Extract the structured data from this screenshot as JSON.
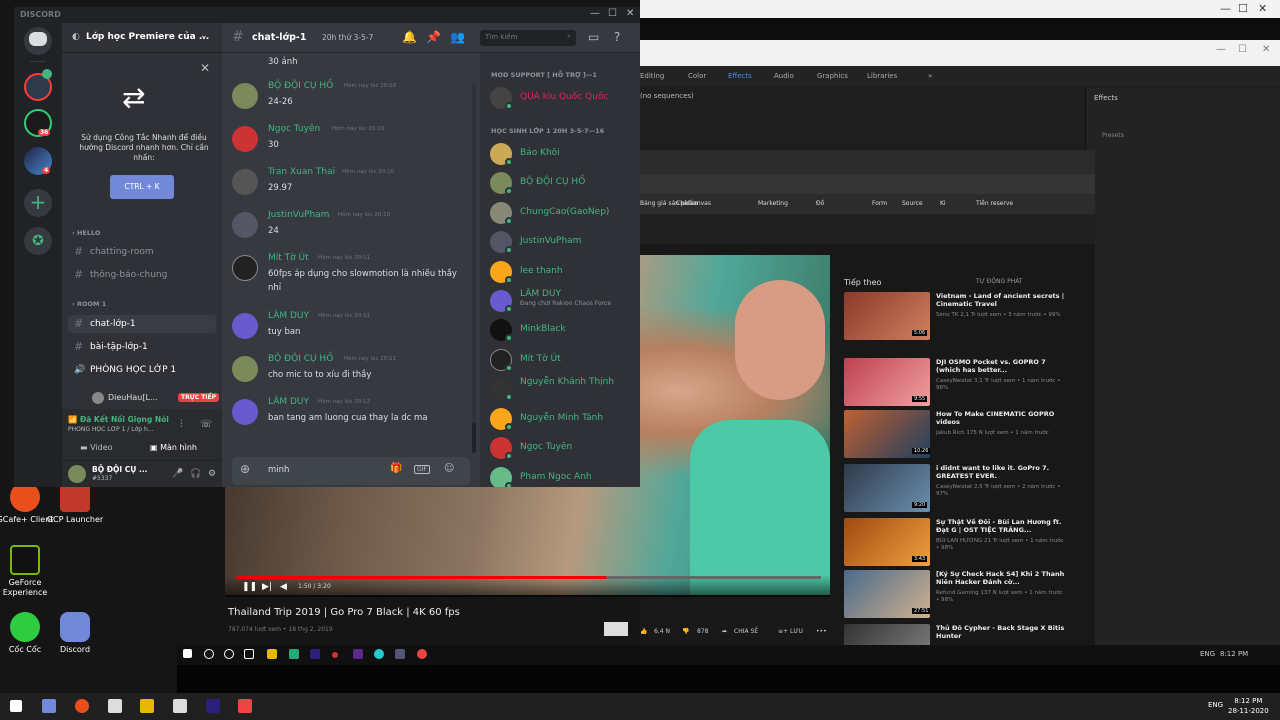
{
  "desktop_icons": [
    {
      "label": "GCafe+ Client"
    },
    {
      "label": "GCP Launcher"
    },
    {
      "label": "GeForce Experience"
    },
    {
      "label": "Cốc Cốc"
    },
    {
      "label": "Discord"
    }
  ],
  "background_app": {
    "menu": [
      "Editing",
      "Color",
      "Effects",
      "Audio",
      "Graphics",
      "Libraries"
    ],
    "effects_panel_title": "Effects",
    "effects_rows": [
      "Presets"
    ],
    "sequence_label": "(no sequences)"
  },
  "youtube": {
    "bookmarks": [
      "Bảng giá sản phẩm",
      "Chatsanvas",
      "Marketing",
      "Đồ",
      "Form",
      "Source",
      "Ki",
      "Tiền reserve"
    ],
    "up_next": "Tiếp theo",
    "autoplay": "TỰ ĐỘNG PHÁT",
    "video_title": "Thailand Trip 2019 | Go Pro 7 Black | 4K 60 fps",
    "video_views": "787.074 lượt xem • 18 thg 2, 2019",
    "video_time": "1:50 / 3:20",
    "likes": "6,4 N",
    "dislikes": "878",
    "share": "CHIA SẺ",
    "save": "LƯU",
    "sidebar": [
      {
        "title": "Vietnam - Land of ancient secrets | Cinematic Travel",
        "sub": "Simo TK\n2,1 Tr lượt xem • 3 năm trước • 99%",
        "dur": "5:06"
      },
      {
        "title": "DJI OSMO Pocket vs. GOPRO 7 (which has better...",
        "sub": "CaseyNeistat\n3,1 Tr lượt xem • 1 năm trước • 96%",
        "dur": "9:55"
      },
      {
        "title": "How To Make CINEMATIC GOPRO videos",
        "sub": "Jakub Rich\n175 N lượt xem • 1 năm trước",
        "dur": "10:26"
      },
      {
        "title": "i didnt want to like it. GoPro 7. GREATEST EVER.",
        "sub": "CaseyNeistat\n2,5 Tr lượt xem • 2 năm trước • 97%",
        "dur": "9:20"
      },
      {
        "title": "Sự Thật Về Đôi - Bùi Lan Hương ft. Đạt G | OST TIỆC TRĂNG...",
        "sub": "BÙI LAN HƯƠNG\n21 Tr lượt xem • 1 năm trước • 98%",
        "dur": "3:43"
      },
      {
        "title": "[Ký Sự Check Hack S4] Khi 2 Thanh Niên Hacker Đánh cờ...",
        "sub": "Refund Gaming\n137 N lượt xem • 1 năm trước • 98%",
        "dur": "27:51"
      },
      {
        "title": "Thủ Đô Cypher - Back Stage X Bitis Hunter",
        "sub": "",
        "dur": ""
      }
    ]
  },
  "discord": {
    "app_name": "DISCORD",
    "server_name": "Lớp học Premiere của ...",
    "guild_badges": [
      "36",
      "4"
    ],
    "promo": {
      "text": "Sử dụng Công Tắc Nhanh để điều hướng Discord nhanh hơn. Chỉ cần nhấn:",
      "button": "CTRL + K"
    },
    "categories": {
      "hello": "HELLO",
      "room": "ROOM 1"
    },
    "channels_hello": [
      "chatting-room",
      "thông-báo-chung"
    ],
    "channels_room": [
      "chat-lớp-1",
      "bài-tập-lớp-1",
      "PHÒNG HỌC LỚP 1"
    ],
    "voice_user": "DieuHau[L...",
    "live_label": "TRỰC TIẾP",
    "voice_connected": "Đã Kết Nối Giọng Nói",
    "voice_channel": "PHÒNG HỌC LỚP 1 / Lớp h...",
    "video_btn": "Video",
    "screen_btn": "Màn hình",
    "user": {
      "name": "BỘ ĐỘI CỤ ...",
      "tag": "#5337"
    },
    "channel": {
      "name": "chat-lớp-1",
      "topic": "20h thứ 3-5-7",
      "search_placeholder": "Tìm kiếm"
    },
    "messages": [
      {
        "name": "",
        "time": "",
        "text": "30 ảnh"
      },
      {
        "name": "BỘ ĐỘI CỤ HỒ",
        "time": "Hôm nay lúc 20:10",
        "text": "24-26"
      },
      {
        "name": "Ngọc Tuyên",
        "time": "Hôm nay lúc 20:10",
        "text": "30"
      },
      {
        "name": "Tran Xuan Thai",
        "time": "Hôm nay lúc 20:10",
        "text": "29.97"
      },
      {
        "name": "JustinVuPham",
        "time": "Hôm nay lúc 20:10",
        "text": "24"
      },
      {
        "name": "Mít Tờ Út",
        "time": "Hôm nay lúc 20:11",
        "text": "60fps áp dụng cho slowmotion là nhiều thầy nhỉ"
      },
      {
        "name": "LÂM DUY",
        "time": "Hôm nay lúc 20:11",
        "text": "tuy ban"
      },
      {
        "name": "BỘ ĐỘI CỤ HỒ",
        "time": "Hôm nay lúc 20:11",
        "text": "cho mic to to xíu đi thầy"
      },
      {
        "name": "LÂM DUY",
        "time": "Hôm nay lúc 20:12",
        "text": "ban tang am luong cua thay la dc ma"
      }
    ],
    "input_value": "minh",
    "input_gif": "GIF",
    "member_cats": {
      "mod": "MOD SUPPORT [ HỖ TRỢ ]—1",
      "students": "HỌC SINH LỚP 1 20H 3-5-7—16"
    },
    "mod_member": "QUÁ kìu Quốc Quốc",
    "members": [
      {
        "name": "Bảo Khôi",
        "sub": ""
      },
      {
        "name": "BỘ ĐỘI CỤ HỒ",
        "sub": ""
      },
      {
        "name": "ChungCao(GaoNep)",
        "sub": ""
      },
      {
        "name": "JustinVuPham",
        "sub": ""
      },
      {
        "name": "lee thanh",
        "sub": ""
      },
      {
        "name": "LÂM DUY",
        "sub": "Đang chơi Rakion Chaos Force"
      },
      {
        "name": "MinkBlack",
        "sub": ""
      },
      {
        "name": "Mít Tờ Út",
        "sub": ""
      },
      {
        "name": "Nguyễn Khánh Thịnh",
        "sub": ""
      },
      {
        "name": "Nguyễn Minh Tánh",
        "sub": ""
      },
      {
        "name": "Ngọc Tuyên",
        "sub": ""
      },
      {
        "name": "Pham Ngoc Anh",
        "sub": ""
      }
    ]
  },
  "inner_taskbar": {
    "lang": "ENG",
    "time": "8:12 PM"
  },
  "taskbar": {
    "lang": "ENG",
    "time": "8:12 PM",
    "date": "28-11-2020"
  },
  "colors": {
    "discord_green": "#43b581",
    "blurple": "#7289da",
    "live_red": "#ed4245",
    "mod_pink": "#e91e63"
  }
}
